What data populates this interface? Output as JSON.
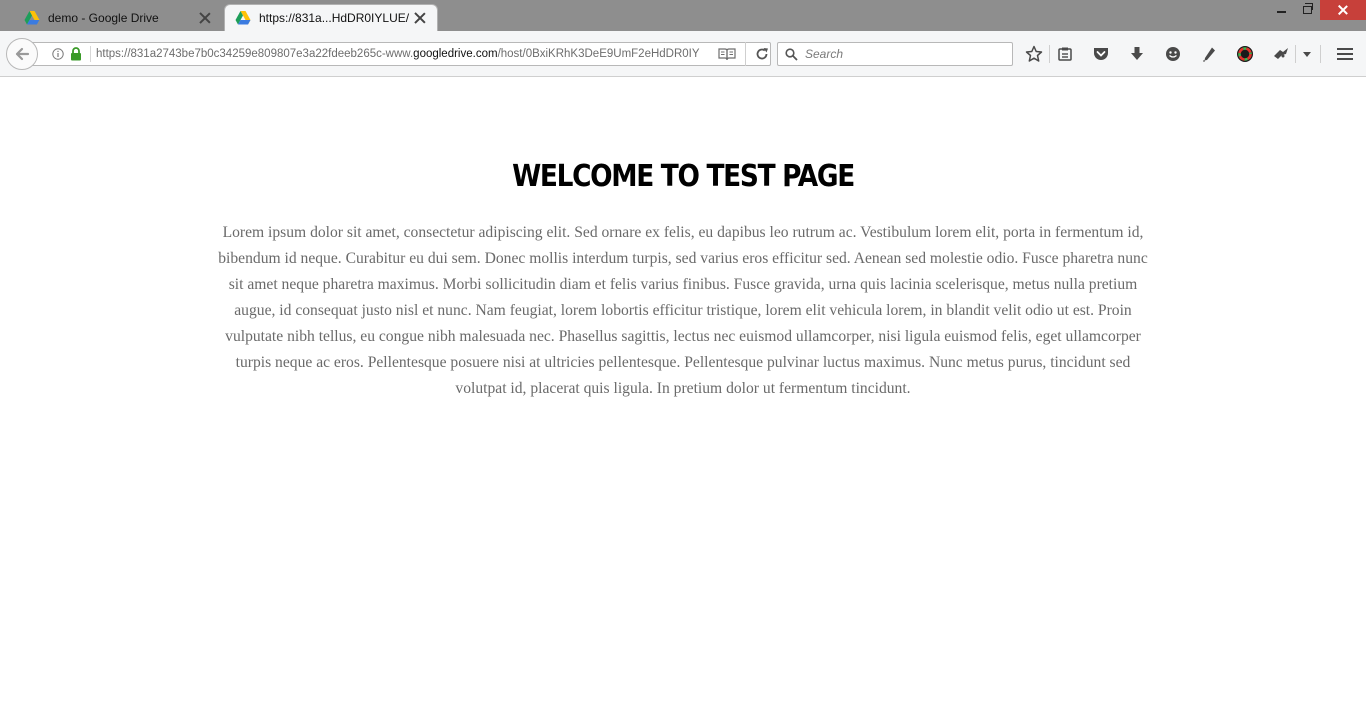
{
  "browser": {
    "tabs": [
      {
        "title": "demo - Google Drive",
        "icon": "google-drive-icon",
        "active": false
      },
      {
        "title": "https://831a...HdDR0IYLUE/",
        "icon": "google-drive-icon",
        "active": true
      }
    ],
    "address_bar": {
      "url_prefix": "https://831a2743be7b0c34259e809807e3a22fdeeb265c-www.",
      "url_domain": "googledrive.com",
      "url_suffix": "/host/0BxiKRhK3DeE9UmF2eHdDR0IY"
    },
    "search": {
      "placeholder": "Search"
    },
    "toolbar_icons": [
      "star-icon",
      "reading-list-icon",
      "pocket-icon",
      "download-icon",
      "emoji-icon",
      "pen-icon",
      "color-circle-icon",
      "extension-icon",
      "chevron-down-icon",
      "hamburger-menu-icon"
    ],
    "colors": {
      "titlebar": "#8e8e8e",
      "close_button": "#c7403a",
      "toolbar": "#f5f6f7"
    }
  },
  "page": {
    "heading": "WELCOME TO TEST PAGE",
    "paragraph": "Lorem ipsum dolor sit amet, consectetur adipiscing elit. Sed ornare ex felis, eu dapibus leo rutrum ac. Vestibulum lorem elit, porta in fermentum id, bibendum id neque. Curabitur eu dui sem. Donec mollis interdum turpis, sed varius eros efficitur sed. Aenean sed molestie odio. Fusce pharetra nunc sit amet neque pharetra maximus. Morbi sollicitudin diam et felis varius finibus. Fusce gravida, urna quis lacinia scelerisque, metus nulla pretium augue, id consequat justo nisl et nunc. Nam feugiat, lorem lobortis efficitur tristique, lorem elit vehicula lorem, in blandit velit odio ut est. Proin vulputate nibh tellus, eu congue nibh malesuada nec. Phasellus sagittis, lectus nec euismod ullamcorper, nisi ligula euismod felis, eget ullamcorper turpis neque ac eros. Pellentesque posuere nisi at ultricies pellentesque. Pellentesque pulvinar luctus maximus. Nunc metus purus, tincidunt sed volutpat id, placerat quis ligula. In pretium dolor ut fermentum tincidunt."
  }
}
